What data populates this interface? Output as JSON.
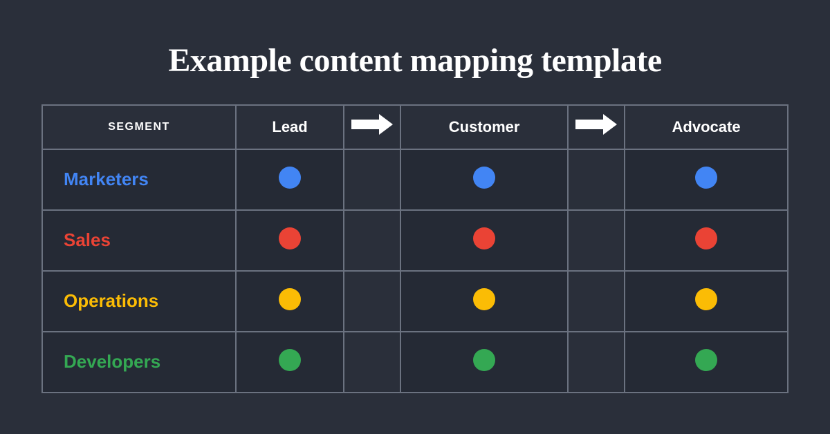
{
  "title": "Example content mapping template",
  "table": {
    "headers": {
      "segment": "SEGMENT",
      "lead": "Lead",
      "customer": "Customer",
      "advocate": "Advocate"
    },
    "rows": [
      {
        "segment": "Marketers",
        "color": "blue",
        "colorHex": "#4285f4"
      },
      {
        "segment": "Sales",
        "color": "red",
        "colorHex": "#ea4335"
      },
      {
        "segment": "Operations",
        "color": "yellow",
        "colorHex": "#fbbc05"
      },
      {
        "segment": "Developers",
        "color": "green",
        "colorHex": "#34a853"
      }
    ]
  }
}
